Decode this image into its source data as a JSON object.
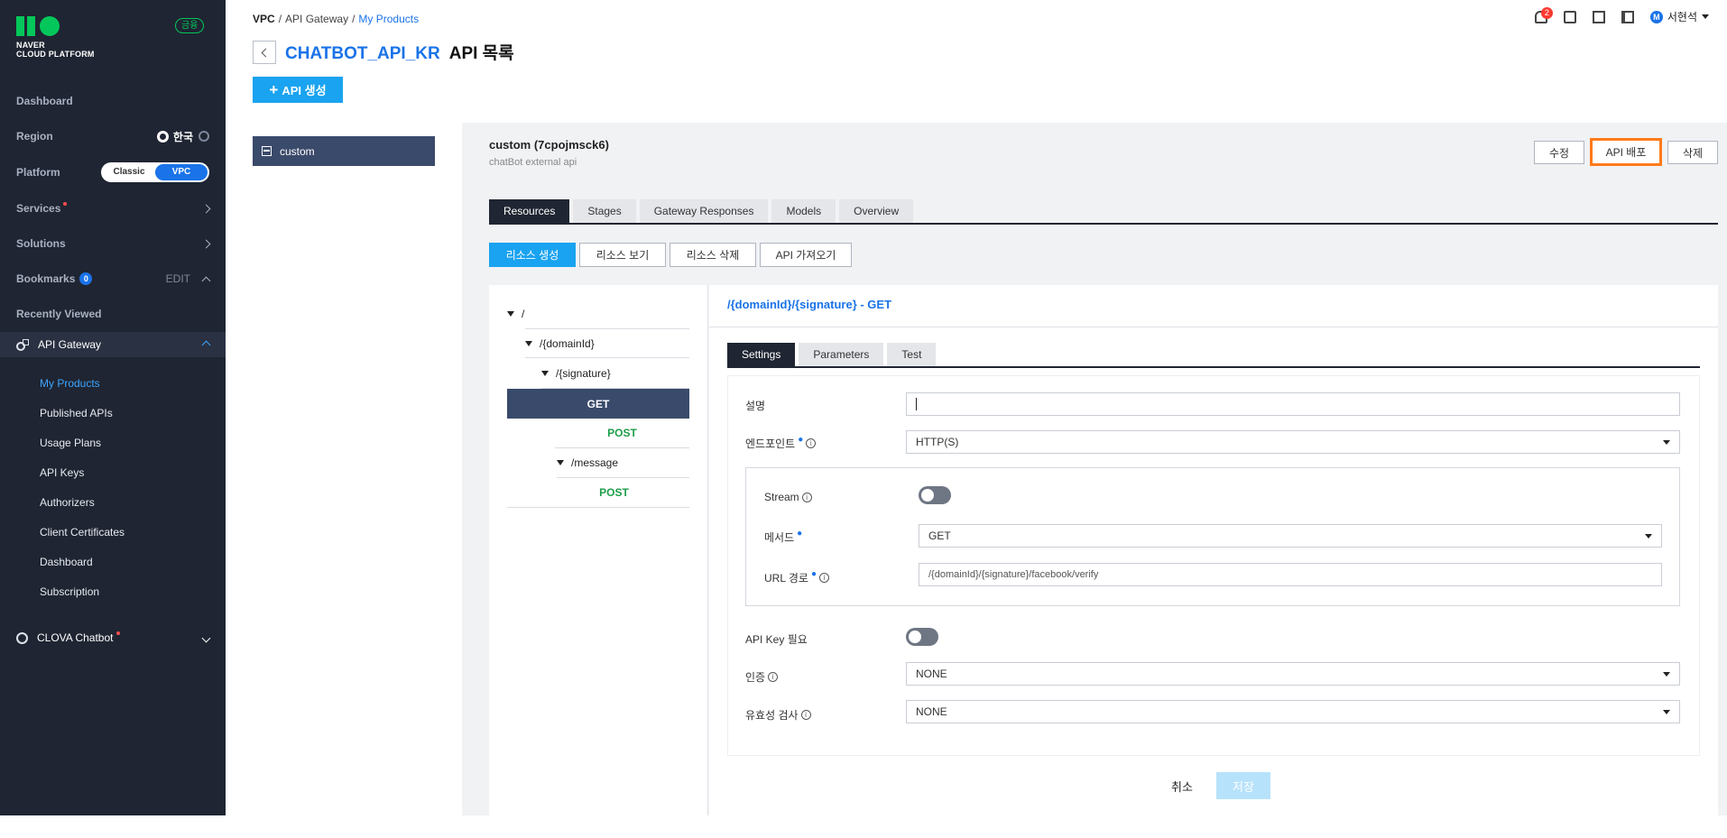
{
  "sidebar": {
    "brand_line1": "NAVER",
    "brand_line2": "CLOUD PLATFORM",
    "plan_badge": "금융",
    "dashboard": "Dashboard",
    "region_label": "Region",
    "region_value": "한국",
    "platform_label": "Platform",
    "platform_options": [
      "Classic",
      "VPC"
    ],
    "platform_selected": "VPC",
    "services": "Services",
    "solutions": "Solutions",
    "bookmarks": "Bookmarks",
    "bookmarks_count": "0",
    "bookmarks_edit": "EDIT",
    "recently_viewed": "Recently Viewed",
    "api_gateway": "API Gateway",
    "api_gateway_items": [
      "My Products",
      "Published APIs",
      "Usage Plans",
      "API Keys",
      "Authorizers",
      "Client Certificates",
      "Dashboard",
      "Subscription"
    ],
    "api_gateway_active": "My Products",
    "clova_chatbot": "CLOVA Chatbot"
  },
  "header": {
    "breadcrumb": [
      "VPC",
      "API Gateway",
      "My Products"
    ],
    "product_name": "CHATBOT_API_KR",
    "page_title": "API 목록",
    "create_api_label": "API 생성",
    "notification_count": "2",
    "user_initial": "M",
    "user_name": "서현석"
  },
  "api_list": {
    "items": [
      "custom"
    ]
  },
  "api_detail": {
    "title": "custom (7cpojmsck6)",
    "description": "chatBot external api",
    "buttons": {
      "edit": "수정",
      "deploy": "API 배포",
      "delete": "삭제"
    },
    "tabs": [
      "Resources",
      "Stages",
      "Gateway Responses",
      "Models",
      "Overview"
    ],
    "active_tab": "Resources",
    "resource_buttons": [
      "리소스 생성",
      "리소스 보기",
      "리소스 삭제",
      "API 가져오기"
    ]
  },
  "resource_tree": {
    "root": "/",
    "domain": "/{domainId}",
    "signature": "/{signature}",
    "get": "GET",
    "post1": "POST",
    "message": "/message",
    "post2": "POST"
  },
  "method_detail": {
    "title": "/{domainId}/{signature} - GET",
    "tabs": [
      "Settings",
      "Parameters",
      "Test"
    ],
    "active_tab": "Settings",
    "description_label": "설명",
    "description_value": "",
    "endpoint_label": "엔드포인트",
    "endpoint_value": "HTTP(S)",
    "stream_label": "Stream",
    "stream_on": false,
    "method_label": "메서드",
    "method_value": "GET",
    "url_path_label": "URL 경로",
    "url_path_value": "/{domainId}/{signature}/facebook/verify",
    "api_key_label": "API Key 필요",
    "api_key_on": false,
    "auth_label": "인증",
    "auth_value": "NONE",
    "validation_label": "유효성 검사",
    "validation_value": "NONE",
    "cancel_label": "취소",
    "save_label": "저장"
  },
  "colors": {
    "accent": "#1a73e8",
    "primary_button": "#1aa3f0",
    "sidebar_bg": "#1f2532",
    "highlight_border": "#ff7a1a",
    "post_method": "#1e9e4a"
  }
}
